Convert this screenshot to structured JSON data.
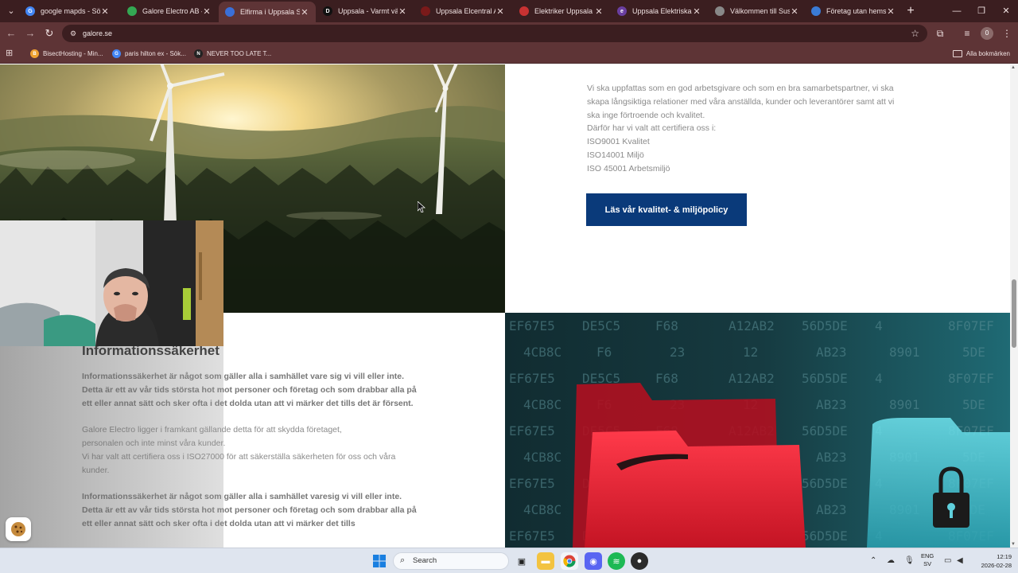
{
  "browser": {
    "tabs": [
      {
        "title": "google mapds - Sök",
        "favicon": "google-favicon",
        "color": "#4285f4",
        "letter": "G",
        "active": false
      },
      {
        "title": "Galore Electro AB – C",
        "favicon": "maps-favicon",
        "color": "#34a853",
        "letter": "",
        "active": false
      },
      {
        "title": "Elfirma i Uppsala Sto",
        "favicon": "generic-favicon",
        "color": "#3a6fd8",
        "letter": "",
        "active": true
      },
      {
        "title": "Uppsala - Varmt välk",
        "favicon": "page-favicon",
        "color": "#111111",
        "letter": "D",
        "active": false
      },
      {
        "title": "Uppsala Elcentral AB",
        "favicon": "page-favicon",
        "color": "#7a1a1a",
        "letter": "",
        "active": false
      },
      {
        "title": "Elektriker Uppsala - E",
        "favicon": "page-favicon",
        "color": "#c83232",
        "letter": "",
        "active": false
      },
      {
        "title": "Uppsala Elektriska | e",
        "favicon": "page-favicon",
        "color": "#6a3fa0",
        "letter": "e",
        "active": false
      },
      {
        "title": "Välkommen till Sushi",
        "favicon": "globe-favicon",
        "color": "#888888",
        "letter": "",
        "active": false
      },
      {
        "title": "Företag utan hemsid",
        "favicon": "page-favicon",
        "color": "#3a7bd5",
        "letter": "",
        "active": false
      }
    ],
    "url": "galore.se",
    "bookmarks": [
      {
        "label": "BisectHosting - Min...",
        "color": "#f0a030",
        "letter": "B"
      },
      {
        "label": "paris hilton ex - Sök...",
        "color": "#4285f4",
        "letter": "G"
      },
      {
        "label": "NEVER TOO LATE T...",
        "color": "#222222",
        "letter": "N"
      }
    ],
    "all_bookmarks": "Alla bokmärken",
    "profile_initial": "0"
  },
  "page": {
    "intro_lines": [
      "Vi ska uppfattas som en god arbetsgivare och som en bra samarbetspartner, vi ska",
      "skapa långsiktiga relationer med våra anställda, kunder och leverantörer samt att vi",
      "ska inge förtroende och kvalitet.",
      "Därför har vi valt att certifiera oss i:",
      "ISO9001 Kvalitet",
      "ISO14001 Miljö",
      "ISO 45001 Arbetsmiljö"
    ],
    "cta_label": "Läs vår kvalitet- & miljöpolicy",
    "infosec": {
      "title": "Informationssäkerhet",
      "bold_paragraph": "Informationssäkerhet är något som gäller alla i samhället vare sig vi vill eller inte. Detta är ett av vår tids största hot mot personer och företag och som drabbar alla på ett eller annat sätt och sker ofta i det dolda utan att vi märker det tills det är försent.",
      "paragraph_2_line_1": "Galore Electro ligger i framkant gällande detta för att skydda företaget,",
      "paragraph_2_line_2": "personalen och inte minst våra kunder.",
      "paragraph_2_line_3": "Vi har valt att certifiera oss i ISO27000 för att säkerställa säkerheten för oss och våra kunder.",
      "bold_paragraph_2": "Informationssäkerhet är något som gäller alla i samhället varesig vi vill eller inte.",
      "bold_paragraph_3": "Detta är ett av vår tids största hot mot personer och företag och som drabbar alla på ett eller annat sätt och sker ofta i det dolda utan att vi märker det tills"
    },
    "hex_codes": [
      "EF67E5",
      "DE5C5",
      "F68",
      "A12AB2",
      "56D5DE",
      "4",
      "8F07EF",
      "4CB8C",
      "F6",
      "23",
      "12",
      "AB23",
      "8901",
      "5DE"
    ]
  },
  "taskbar": {
    "search_label": "Search",
    "lang_1": "ENG",
    "lang_2": "SV",
    "time": "12:19",
    "date": "2026-02-28"
  }
}
